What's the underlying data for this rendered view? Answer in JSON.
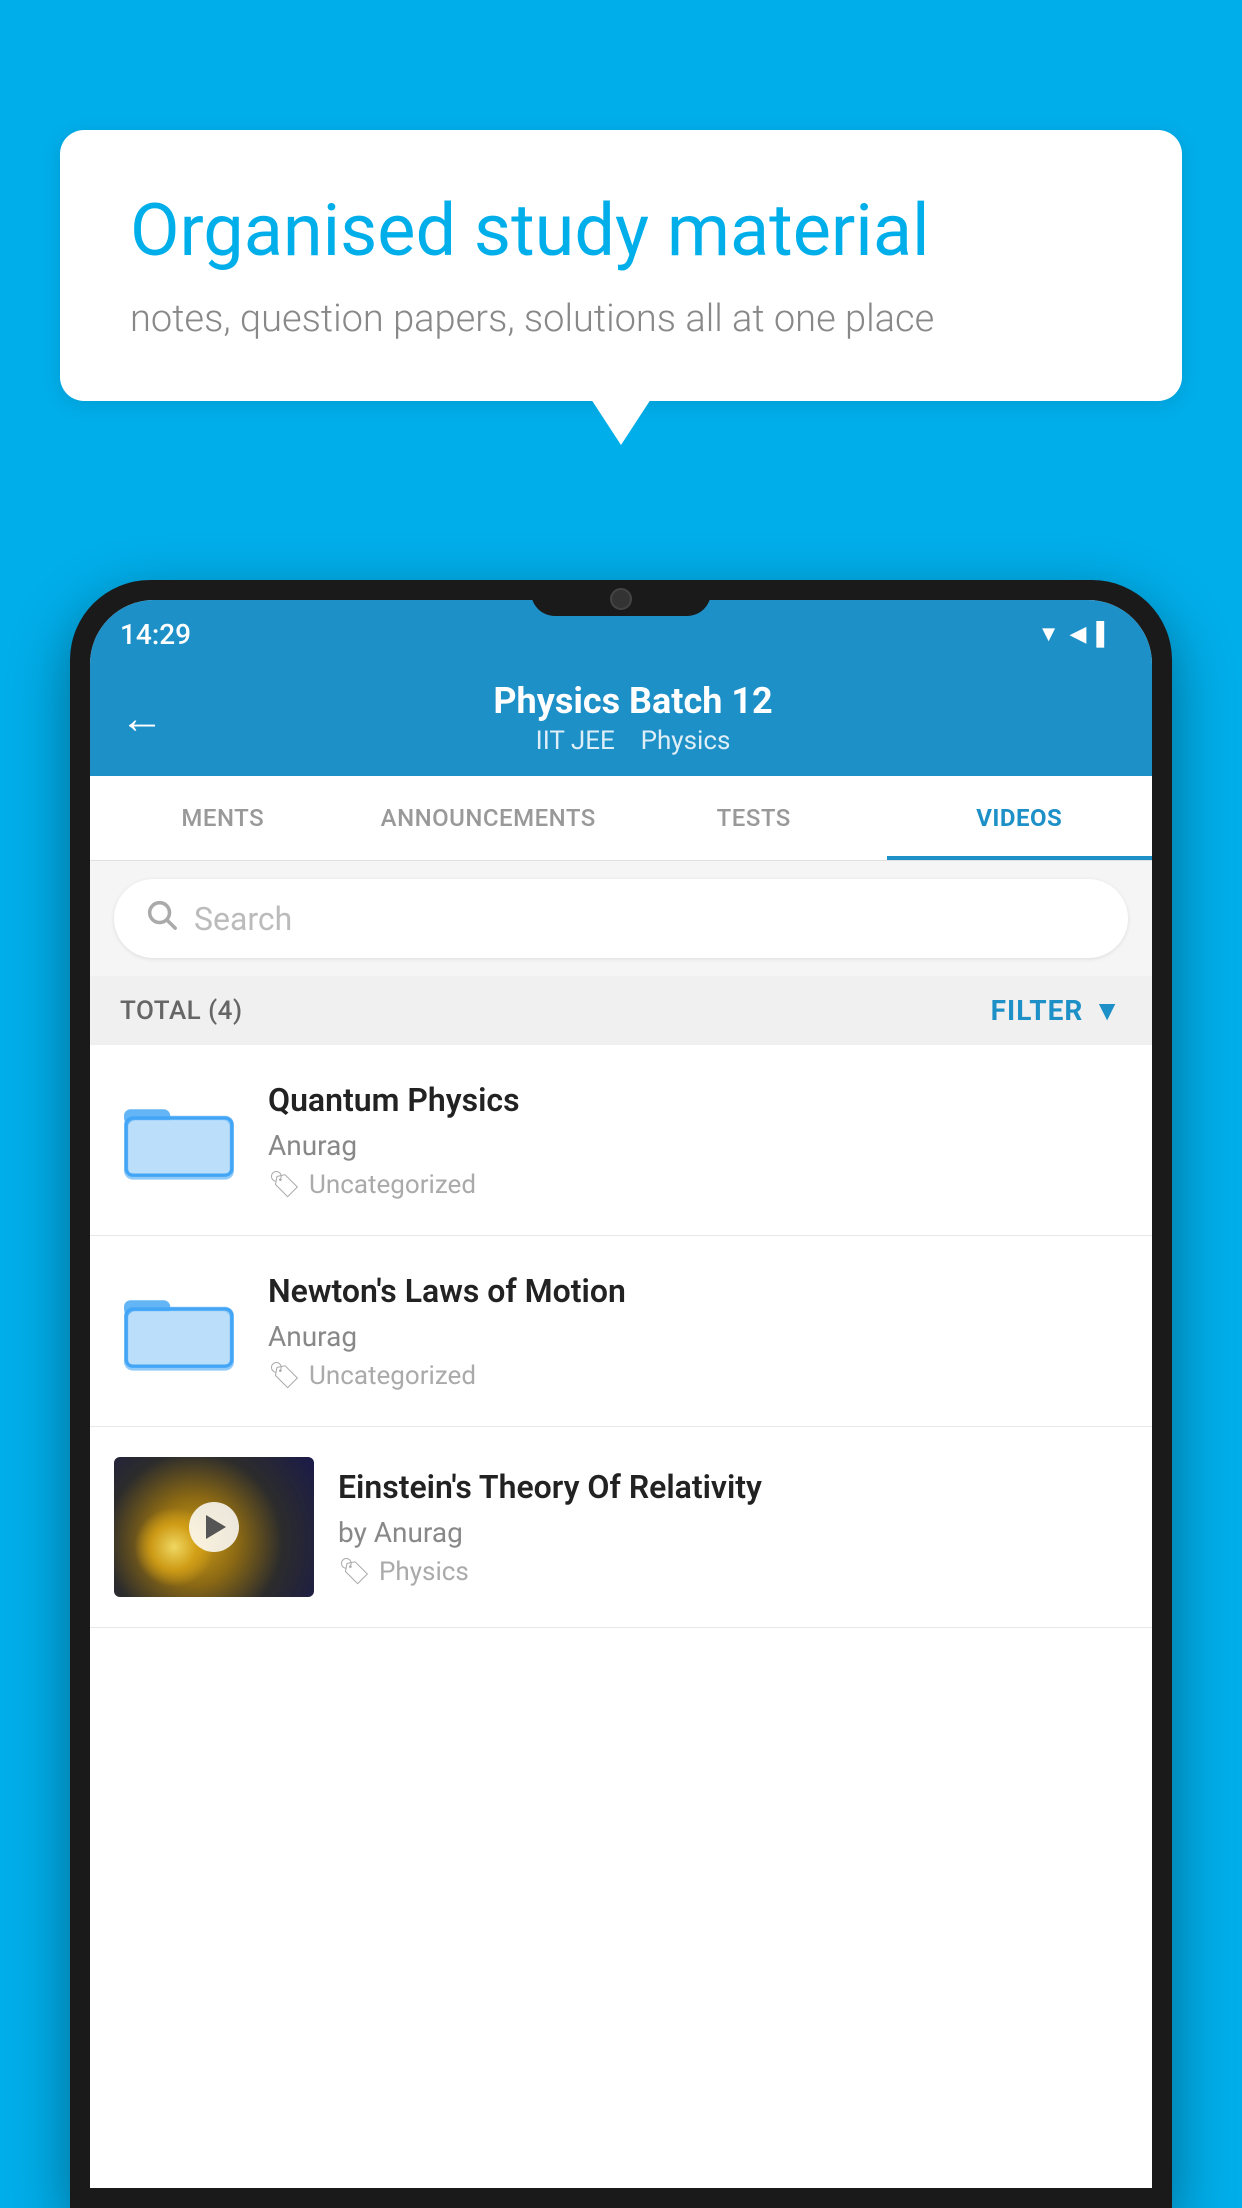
{
  "background_color": "#00AEEA",
  "speech_bubble": {
    "heading": "Organised study material",
    "subtext": "notes, question papers, solutions all at one place"
  },
  "phone": {
    "status_bar": {
      "time": "14:29",
      "icons": "▼◀▌"
    },
    "header": {
      "back_label": "←",
      "title": "Physics Batch 12",
      "subtitle_part1": "IIT JEE",
      "subtitle_part2": "Physics"
    },
    "tabs": [
      {
        "label": "MENTS",
        "active": false
      },
      {
        "label": "ANNOUNCEMENTS",
        "active": false
      },
      {
        "label": "TESTS",
        "active": false
      },
      {
        "label": "VIDEOS",
        "active": true
      }
    ],
    "search": {
      "placeholder": "Search"
    },
    "filter_bar": {
      "total_label": "TOTAL (4)",
      "filter_label": "FILTER"
    },
    "videos": [
      {
        "id": 1,
        "title": "Quantum Physics",
        "author": "Anurag",
        "tag": "Uncategorized",
        "type": "folder"
      },
      {
        "id": 2,
        "title": "Newton's Laws of Motion",
        "author": "Anurag",
        "tag": "Uncategorized",
        "type": "folder"
      },
      {
        "id": 3,
        "title": "Einstein's Theory Of Relativity",
        "author": "by Anurag",
        "tag": "Physics",
        "type": "video"
      }
    ]
  }
}
